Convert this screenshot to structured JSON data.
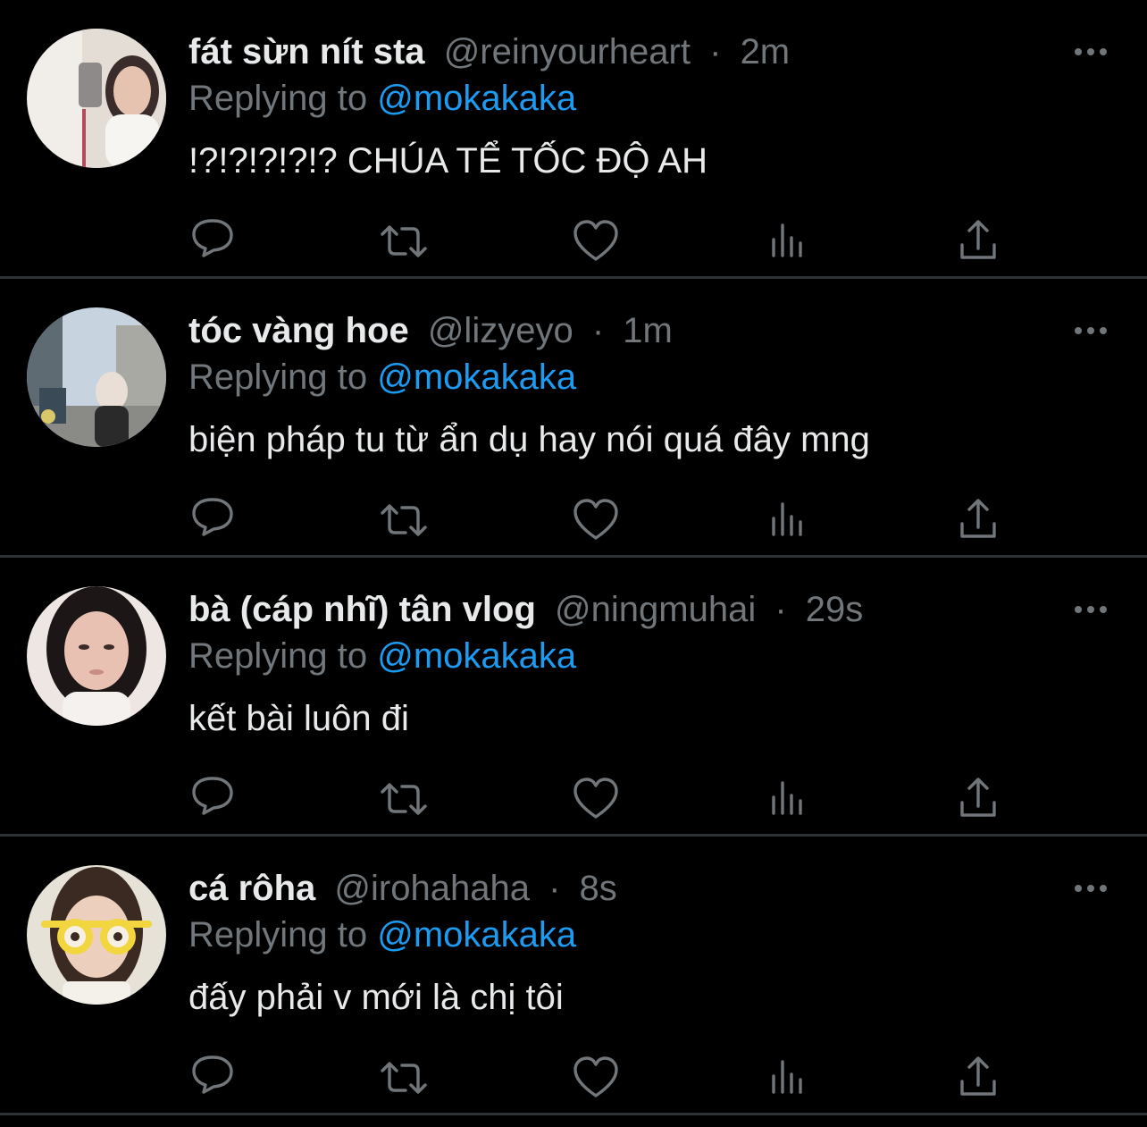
{
  "tweets": [
    {
      "display_name": "fát sừn nít sta",
      "handle": "@reinyourheart",
      "separator": "·",
      "time": "2m",
      "replying_prefix": "Replying to",
      "reply_to": "@mokakaka",
      "text": "!?!?!?!?!? CHÚA TỂ TỐC ĐỘ AH",
      "avatar_colors": [
        "#f1ede8",
        "#d9b7a4",
        "#3a2c2a"
      ]
    },
    {
      "display_name": "tóc vàng hoe",
      "handle": "@lizyeyo",
      "separator": "·",
      "time": "1m",
      "replying_prefix": "Replying to",
      "reply_to": "@mokakaka",
      "text": "biện pháp tu từ ẩn dụ hay nói quá đây mng",
      "avatar_colors": [
        "#b9c6d3",
        "#7a7f86",
        "#2b2a2a"
      ]
    },
    {
      "display_name": "bà (cáp nhĩ) tân vlog",
      "handle": "@ningmuhai",
      "separator": "·",
      "time": "29s",
      "replying_prefix": "Replying to",
      "reply_to": "@mokakaka",
      "text": "kết bài luôn đi",
      "avatar_colors": [
        "#eee6e2",
        "#e8c1b3",
        "#1c1616"
      ]
    },
    {
      "display_name": "cá rôha",
      "handle": "@irohahaha",
      "separator": "·",
      "time": "8s",
      "replying_prefix": "Replying to",
      "reply_to": "@mokakaka",
      "text": "đấy phải v mới là chị tôi",
      "avatar_colors": [
        "#e7e2d7",
        "#f2d640",
        "#3a2a22"
      ]
    }
  ],
  "icons": {
    "reply": "reply-icon",
    "retweet": "retweet-icon",
    "like": "heart-icon",
    "views": "views-icon",
    "share": "share-icon",
    "more": "more-options-icon"
  },
  "colors": {
    "background": "#000000",
    "text": "#e7e9ea",
    "secondary": "#71767b",
    "link": "#1d9bf0",
    "divider": "#2f3336"
  }
}
